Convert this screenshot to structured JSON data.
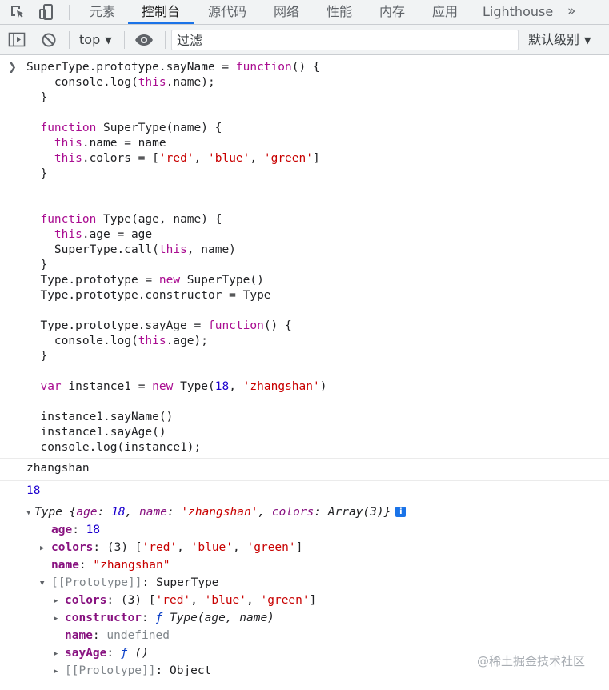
{
  "tabs": [
    {
      "label": "元素",
      "active": false
    },
    {
      "label": "控制台",
      "active": true
    },
    {
      "label": "源代码",
      "active": false
    },
    {
      "label": "网络",
      "active": false
    },
    {
      "label": "性能",
      "active": false
    },
    {
      "label": "内存",
      "active": false
    },
    {
      "label": "应用",
      "active": false
    },
    {
      "label": "Lighthouse",
      "active": false
    }
  ],
  "tabs_overflow": "»",
  "toolbar": {
    "context": "top",
    "filter_placeholder": "过滤",
    "log_level": "默认级别"
  },
  "icons": [
    "inspect-icon",
    "device-toggle-icon",
    "sidebar-toggle-icon",
    "clear-console-icon",
    "eye-icon",
    "chevron-down-icon",
    "info-icon"
  ],
  "input_code": [
    "SuperType.prototype.sayName = function() {",
    "    console.log(this.name);",
    "  }",
    "",
    "  function SuperType(name) {",
    "    this.name = name",
    "    this.colors = ['red', 'blue', 'green']",
    "  }",
    "",
    "",
    "  function Type(age, name) {",
    "    this.age = age",
    "    SuperType.call(this, name)",
    "  }",
    "  Type.prototype = new SuperType()",
    "  Type.prototype.constructor = Type",
    "",
    "  Type.prototype.sayAge = function() {",
    "    console.log(this.age);",
    "  }",
    "",
    "  var instance1 = new Type(18, 'zhangshan')",
    "",
    "  instance1.sayName()",
    "  instance1.sayAge()",
    "  console.log(instance1);"
  ],
  "outputs": [
    "zhangshan",
    "18"
  ],
  "object_tree": {
    "summary_type": "Type",
    "summary_age": "18",
    "summary_name": "'zhangshan'",
    "summary_colors": "Array(3)",
    "age": "18",
    "colors": "(3) ['red', 'blue', 'green']",
    "name": "\"zhangshan\"",
    "prototype_label": "[[Prototype]]",
    "prototype_value": "SuperType",
    "proto_colors": "(3) ['red', 'blue', 'green']",
    "proto_constructor": "Type(age, name)",
    "proto_name": "undefined",
    "proto_sayAge": "()",
    "proto_prototype_value": "Object"
  },
  "watermark": "@稀土掘金技术社区",
  "colors": {
    "keyword": "#aa0d91",
    "string": "#c80000",
    "number": "#1c00cf",
    "property": "#881280",
    "accent": "#1a73e8"
  }
}
